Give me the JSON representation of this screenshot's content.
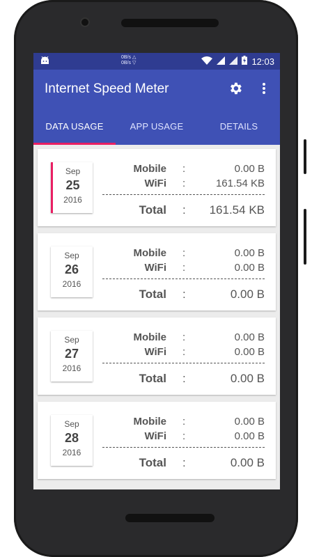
{
  "status_bar": {
    "speed_up": "0B/s △",
    "speed_down": "0B/s ▽",
    "time": "12:03"
  },
  "toolbar": {
    "title": "Internet Speed Meter"
  },
  "tabs": [
    {
      "label": "DATA USAGE",
      "active": true
    },
    {
      "label": "APP USAGE",
      "active": false
    },
    {
      "label": "DETAILS",
      "active": false
    }
  ],
  "labels": {
    "mobile": "Mobile",
    "wifi": "WiFi",
    "total": "Total",
    "colon": ":"
  },
  "days": [
    {
      "month": "Sep",
      "day": "25",
      "year": "2016",
      "mobile": "0.00 B",
      "wifi": "161.54 KB",
      "total": "161.54 KB",
      "selected": true
    },
    {
      "month": "Sep",
      "day": "26",
      "year": "2016",
      "mobile": "0.00 B",
      "wifi": "0.00 B",
      "total": "0.00 B",
      "selected": false
    },
    {
      "month": "Sep",
      "day": "27",
      "year": "2016",
      "mobile": "0.00 B",
      "wifi": "0.00 B",
      "total": "0.00 B",
      "selected": false
    },
    {
      "month": "Sep",
      "day": "28",
      "year": "2016",
      "mobile": "0.00 B",
      "wifi": "0.00 B",
      "total": "0.00 B",
      "selected": false
    }
  ],
  "colors": {
    "primary": "#3f51b5",
    "primary_dark": "#2f3c91",
    "accent": "#e91e63"
  },
  "icons": [
    "android-icon",
    "wifi-icon",
    "signal-icon",
    "battery-charging-icon",
    "settings-gear-icon",
    "more-vert-icon"
  ]
}
